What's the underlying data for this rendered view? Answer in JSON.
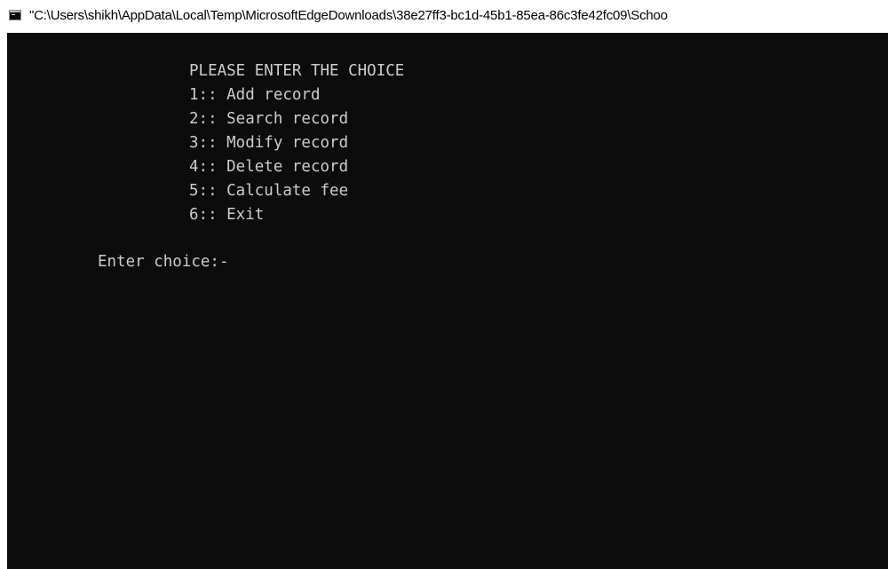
{
  "window": {
    "title": "\"C:\\Users\\shikh\\AppData\\Local\\Temp\\MicrosoftEdgeDownloads\\38e27ff3-bc1d-45b1-85ea-86c3fe42fc09\\Schoo",
    "icon": "console-window-icon"
  },
  "console": {
    "heading": "PLEASE ENTER THE CHOICE",
    "menu": [
      "1:: Add record",
      "2:: Search record",
      "3:: Modify record",
      "4:: Delete record",
      "5:: Calculate fee",
      "6:: Exit"
    ],
    "prompt": "Enter choice:-"
  },
  "colors": {
    "console_background": "#0c0c0c",
    "console_text": "#cccccc",
    "titlebar_background": "#ffffff"
  }
}
